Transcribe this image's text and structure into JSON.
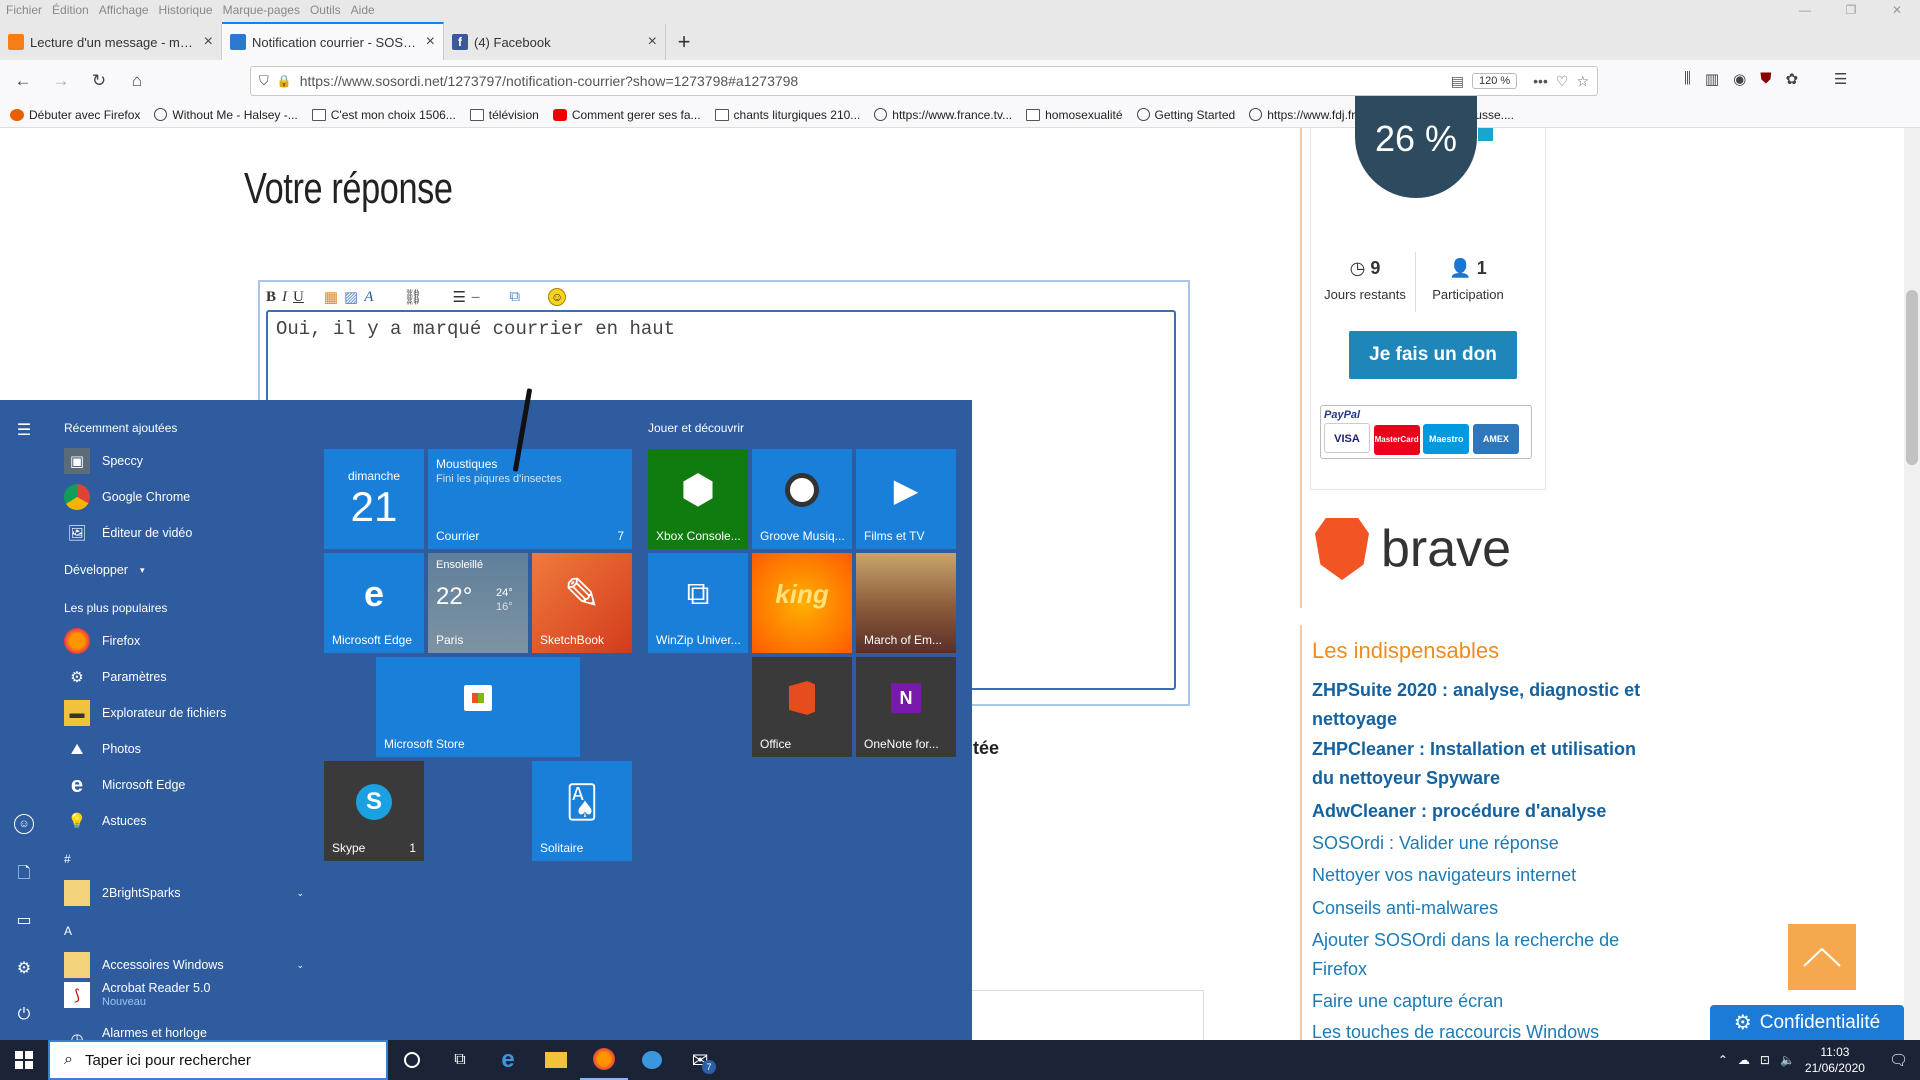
{
  "menubar": {
    "items": [
      "Fichier",
      "Édition",
      "Affichage",
      "Historique",
      "Marque-pages",
      "Outils",
      "Aide"
    ]
  },
  "tabs": [
    {
      "title": "Lecture d'un message - mail O",
      "favicon_color": "#f77d16",
      "active": false
    },
    {
      "title": "Notification courrier - SOSOrdi",
      "favicon_color": "#2a7ad2",
      "active": true
    },
    {
      "title": "(4) Facebook",
      "favicon_color": "#3b5998",
      "active": false
    }
  ],
  "urlbar": {
    "url": "https://www.sosordi.net/1273797/notification-courrier?show=1273798#a1273798",
    "zoom": "120 %"
  },
  "bookmarks": [
    {
      "label": "Débuter avec Firefox",
      "icon": "firefox-icon"
    },
    {
      "label": "Without Me - Halsey -...",
      "icon": "globe-icon"
    },
    {
      "label": "C'est mon choix  1506...",
      "icon": "folder-icon"
    },
    {
      "label": "télévision",
      "icon": "folder-icon"
    },
    {
      "label": "Comment gerer ses fa...",
      "icon": "youtube-icon"
    },
    {
      "label": "chants liturgiques 210...",
      "icon": "folder-icon"
    },
    {
      "label": "https://www.france.tv...",
      "icon": "globe-icon"
    },
    {
      "label": "homosexualité",
      "icon": "folder-icon"
    },
    {
      "label": "Getting Started",
      "icon": "globe-icon"
    },
    {
      "label": "https://www.fdj.fr/",
      "icon": "globe-icon"
    },
    {
      "label": "https://www.larousse....",
      "icon": "globe-icon"
    }
  ],
  "page": {
    "reply_title": "Votre réponse",
    "editor_text": "Oui, il y a marqué courrier en haut",
    "editor_toolbar": [
      "B",
      "I",
      "U"
    ],
    "partial_word": "ntée"
  },
  "donation": {
    "percent": "26 %",
    "days_value": "9",
    "days_label": "Jours restants",
    "participants_value": "1",
    "participants_label": "Participation",
    "button": "Je fais un don",
    "paypal_label": "PayPal",
    "cards": [
      "VISA",
      "MasterCard",
      "Maestro",
      "AMEX"
    ]
  },
  "brave": {
    "text": "brave"
  },
  "indispensables": {
    "title": "Les indispensables",
    "links": [
      {
        "text": "ZHPSuite 2020 : analyse, diagnostic et nettoyage",
        "bold": true
      },
      {
        "text": "ZHPCleaner : Installation et utilisation du nettoyeur Spyware",
        "bold": true
      },
      {
        "text": "AdwCleaner : procédure d'analyse",
        "bold": true
      },
      {
        "text": "SOSOrdi : Valider une réponse",
        "bold": false
      },
      {
        "text": "Nettoyer vos navigateurs internet",
        "bold": false
      },
      {
        "text": "Conseils anti-malwares",
        "bold": false
      },
      {
        "text": "Ajouter SOSOrdi dans la recherche de Firefox",
        "bold": false
      },
      {
        "text": "Faire une capture écran",
        "bold": false
      },
      {
        "text": "Les touches de raccourcis Windows",
        "bold": false
      }
    ]
  },
  "privacy_button": "Confidentialité",
  "startmenu": {
    "recent_header": "Récemment ajoutées",
    "recent": [
      {
        "label": "Speccy",
        "color": "#5a6b7a"
      },
      {
        "label": "Google Chrome",
        "color": "#ffffff"
      },
      {
        "label": "Éditeur de vidéo",
        "color": "#2f5b9f"
      }
    ],
    "expand": "Développer",
    "popular_header": "Les plus populaires",
    "popular": [
      {
        "label": "Firefox",
        "color": "#e66000"
      },
      {
        "label": "Paramètres",
        "color": "#2f5b9f"
      },
      {
        "label": "Explorateur de fichiers",
        "color": "#f3c23c"
      },
      {
        "label": "Photos",
        "color": "#2f5b9f"
      },
      {
        "label": "Microsoft Edge",
        "color": "#2f5b9f"
      },
      {
        "label": "Astuces",
        "color": "#2f5b9f"
      }
    ],
    "hash": "#",
    "letter_a": "A",
    "alpha": [
      {
        "label": "2BrightSparks",
        "sub": "",
        "folder": true
      },
      {
        "label": "Accessoires Windows",
        "sub": "",
        "folder": true
      },
      {
        "label": "Acrobat Reader 5.0",
        "sub": "Nouveau",
        "folder": false
      },
      {
        "label": "Alarmes et horloge",
        "sub": "",
        "folder": false
      }
    ],
    "group2_header": "Jouer et découvrir",
    "tiles": {
      "calendar_day": "dimanche",
      "calendar_num": "21",
      "mail_title": "Moustiques",
      "mail_sub": "Fini les piqures d'insectes",
      "mail_label": "Courrier",
      "mail_count": "7",
      "edge": "Microsoft Edge",
      "weather_cond": "Ensoleillé",
      "weather_temp": "22°",
      "weather_hi": "24°",
      "weather_lo": "16°",
      "weather_city": "Paris",
      "sketchbook": "SketchBook",
      "store": "Microsoft Store",
      "skype": "Skype",
      "skype_count": "1",
      "solitaire": "Solitaire",
      "xbox": "Xbox Console...",
      "groove": "Groove Musiq...",
      "films": "Films et TV",
      "winzip": "WinZip Univer...",
      "king": "king",
      "march": "March of Em...",
      "office": "Office",
      "onenote": "OneNote for..."
    }
  },
  "taskbar": {
    "search_placeholder": "Taper ici pour rechercher",
    "mail_badge": "7",
    "time": "11:03",
    "date": "21/06/2020"
  }
}
